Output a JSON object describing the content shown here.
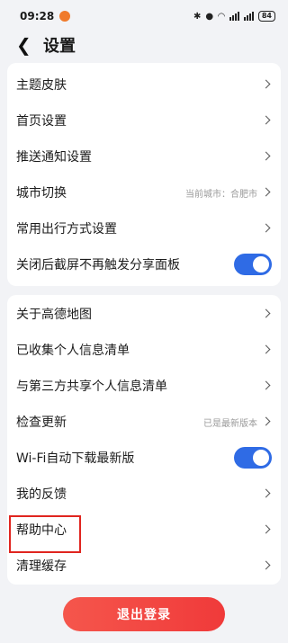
{
  "status_bar": {
    "time": "09:28",
    "battery": "84"
  },
  "header": {
    "title": "设置"
  },
  "group1": [
    {
      "label": "主题皮肤"
    },
    {
      "label": "首页设置"
    },
    {
      "label": "推送通知设置"
    },
    {
      "label": "城市切换",
      "value": "当前城市：合肥市"
    },
    {
      "label": "常用出行方式设置"
    },
    {
      "label": "关闭后截屏不再触发分享面板",
      "toggle": true
    }
  ],
  "group2": [
    {
      "label": "关于高德地图"
    },
    {
      "label": "已收集个人信息清单"
    },
    {
      "label": "与第三方共享个人信息清单"
    },
    {
      "label": "检查更新",
      "value": "已是最新版本"
    },
    {
      "label": "Wi-Fi自动下载最新版",
      "toggle": true
    },
    {
      "label": "我的反馈"
    },
    {
      "label": "帮助中心",
      "highlighted": true
    },
    {
      "label": "清理缓存"
    }
  ],
  "logout_label": "退出登录",
  "colors": {
    "accent": "#2f6be5",
    "logout": "#f04a42",
    "highlight": "#e0251f"
  }
}
